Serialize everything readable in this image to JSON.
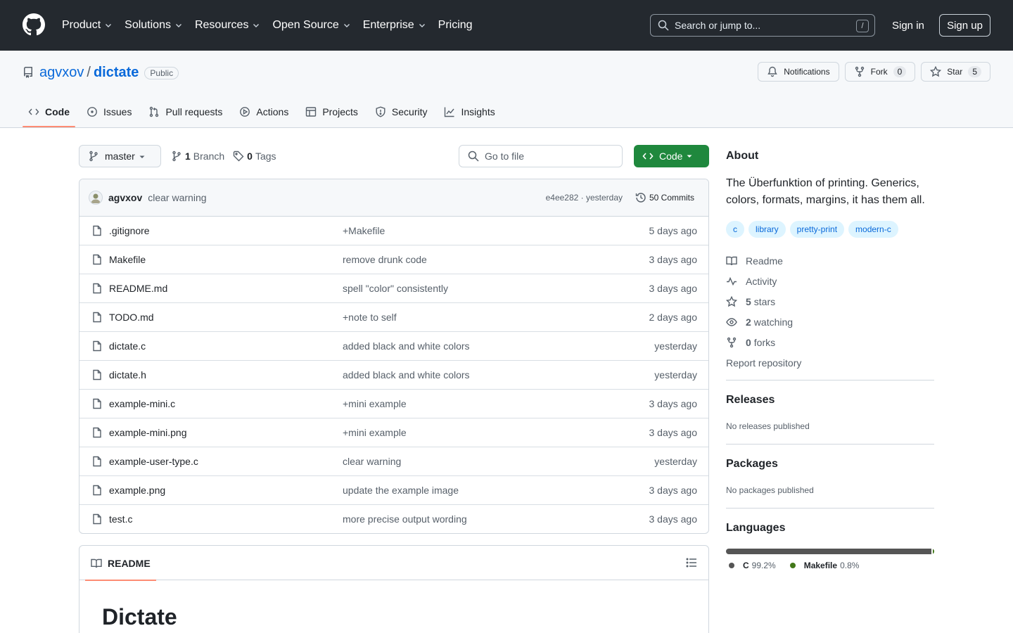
{
  "nav": {
    "items": [
      {
        "label": "Product",
        "dropdown": true
      },
      {
        "label": "Solutions",
        "dropdown": true
      },
      {
        "label": "Resources",
        "dropdown": true
      },
      {
        "label": "Open Source",
        "dropdown": true
      },
      {
        "label": "Enterprise",
        "dropdown": true
      },
      {
        "label": "Pricing",
        "dropdown": false
      }
    ],
    "search_placeholder": "Search or jump to...",
    "search_shortcut": "/",
    "sign_in": "Sign in",
    "sign_up": "Sign up"
  },
  "repo": {
    "owner": "agvxov",
    "separator": "/",
    "name": "dictate",
    "visibility": "Public",
    "notifications_label": "Notifications",
    "fork_label": "Fork",
    "fork_count": "0",
    "star_label": "Star",
    "star_count": "5"
  },
  "tabs": [
    {
      "label": "Code",
      "icon": "code-icon",
      "active": true
    },
    {
      "label": "Issues",
      "icon": "issue-icon",
      "active": false
    },
    {
      "label": "Pull requests",
      "icon": "pull-request-icon",
      "active": false
    },
    {
      "label": "Actions",
      "icon": "play-icon",
      "active": false
    },
    {
      "label": "Projects",
      "icon": "table-icon",
      "active": false
    },
    {
      "label": "Security",
      "icon": "shield-icon",
      "active": false
    },
    {
      "label": "Insights",
      "icon": "graph-icon",
      "active": false
    }
  ],
  "toolbar": {
    "branch": "master",
    "branch_count": "1",
    "branch_word": "Branch",
    "tag_count": "0",
    "tag_word": "Tags",
    "goto_placeholder": "Go to file",
    "code_button": "Code"
  },
  "commit": {
    "author": "agvxov",
    "message": "clear warning",
    "meta": "e4ee282 · yesterday",
    "count_label": "50 Commits"
  },
  "files": [
    {
      "name": ".gitignore",
      "message": "+Makefile",
      "date": "5 days ago"
    },
    {
      "name": "Makefile",
      "message": "remove drunk code",
      "date": "3 days ago"
    },
    {
      "name": "README.md",
      "message": "spell \"color\" consistently",
      "date": "3 days ago"
    },
    {
      "name": "TODO.md",
      "message": "+note to self",
      "date": "2 days ago"
    },
    {
      "name": "dictate.c",
      "message": "added black and white colors",
      "date": "yesterday"
    },
    {
      "name": "dictate.h",
      "message": "added black and white colors",
      "date": "yesterday"
    },
    {
      "name": "example-mini.c",
      "message": "+mini example",
      "date": "3 days ago"
    },
    {
      "name": "example-mini.png",
      "message": "+mini example",
      "date": "3 days ago"
    },
    {
      "name": "example-user-type.c",
      "message": "clear warning",
      "date": "yesterday"
    },
    {
      "name": "example.png",
      "message": "update the example image",
      "date": "3 days ago"
    },
    {
      "name": "test.c",
      "message": "more precise output wording",
      "date": "3 days ago"
    }
  ],
  "readme": {
    "tab_label": "README",
    "heading": "Dictate"
  },
  "about": {
    "title": "About",
    "description": "The Überfunktion of printing. Generics, colors, formats, margins, it has them all.",
    "topics": [
      "c",
      "library",
      "pretty-print",
      "modern-c"
    ],
    "links": [
      {
        "icon": "book-icon",
        "count": "",
        "label": "Readme"
      },
      {
        "icon": "pulse-icon",
        "count": "",
        "label": "Activity"
      },
      {
        "icon": "star-icon",
        "count": "5",
        "label": "stars"
      },
      {
        "icon": "eye-icon",
        "count": "2",
        "label": "watching"
      },
      {
        "icon": "fork-icon",
        "count": "0",
        "label": "forks"
      }
    ],
    "report": "Report repository"
  },
  "releases": {
    "title": "Releases",
    "sub": "No releases published"
  },
  "packages": {
    "title": "Packages",
    "sub": "No packages published"
  },
  "languages": {
    "title": "Languages",
    "items": [
      {
        "name": "C",
        "percent": "99.2%",
        "value": 99.2,
        "color": "#555555"
      },
      {
        "name": "Makefile",
        "percent": "0.8%",
        "value": 0.8,
        "color": "#427819"
      }
    ]
  },
  "colors": {
    "header_bg": "#24292f",
    "link": "#0969da",
    "primary_button": "#1f883d",
    "active_tab_underline": "#fd8c73"
  }
}
